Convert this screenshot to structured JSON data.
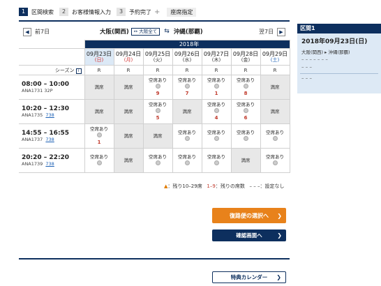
{
  "steps": [
    {
      "num": "1",
      "label": "区間検索"
    },
    {
      "num": "2",
      "label": "お客様情報入力"
    },
    {
      "num": "3",
      "label": "予約完了"
    }
  ],
  "steps_plus": "+",
  "steps_extra": "座席指定",
  "nav": {
    "prev": "前7日",
    "next": "翌7日",
    "origin": "大阪(関西)",
    "all_button": "大阪全て",
    "destination": "沖縄(那覇)"
  },
  "year": "2018年",
  "dates": [
    {
      "date": "09月23日",
      "dow": "(日)",
      "type": "sun"
    },
    {
      "date": "09月24日",
      "dow": "(月)",
      "type": "sun"
    },
    {
      "date": "09月25日",
      "dow": "(火)",
      "type": "wd"
    },
    {
      "date": "09月26日",
      "dow": "(水)",
      "type": "wd"
    },
    {
      "date": "09月27日",
      "dow": "(木)",
      "type": "wd"
    },
    {
      "date": "09月28日",
      "dow": "(金)",
      "type": "wd"
    },
    {
      "date": "09月29日",
      "dow": "(土)",
      "type": "sat"
    }
  ],
  "season_label": "シーズン",
  "season_icon": "i",
  "seasons": [
    "R",
    "R",
    "R",
    "R",
    "R",
    "R",
    "R"
  ],
  "flights": [
    {
      "time": "08:00 – 10:00",
      "number": "ANA1731",
      "aircraft": "32P",
      "aircraft_link": false,
      "cells": [
        {
          "s": "満席",
          "n": ""
        },
        {
          "s": "満席",
          "n": ""
        },
        {
          "s": "空席あり",
          "n": "9"
        },
        {
          "s": "空席あり",
          "n": "7"
        },
        {
          "s": "空席あり",
          "n": "1"
        },
        {
          "s": "空席あり",
          "n": "8"
        },
        {
          "s": "満席",
          "n": ""
        }
      ]
    },
    {
      "time": "10:20 – 12:30",
      "number": "ANA1735",
      "aircraft": "738",
      "aircraft_link": true,
      "cells": [
        {
          "s": "満席",
          "n": ""
        },
        {
          "s": "満席",
          "n": ""
        },
        {
          "s": "空席あり",
          "n": "5"
        },
        {
          "s": "満席",
          "n": ""
        },
        {
          "s": "空席あり",
          "n": "4"
        },
        {
          "s": "空席あり",
          "n": "6"
        },
        {
          "s": "満席",
          "n": ""
        }
      ]
    },
    {
      "time": "14:55 – 16:55",
      "number": "ANA1737",
      "aircraft": "738",
      "aircraft_link": true,
      "cells": [
        {
          "s": "空席あり",
          "n": "1"
        },
        {
          "s": "満席",
          "n": ""
        },
        {
          "s": "満席",
          "n": ""
        },
        {
          "s": "空席あり",
          "n": ""
        },
        {
          "s": "空席あり",
          "n": ""
        },
        {
          "s": "空席あり",
          "n": ""
        },
        {
          "s": "空席あり",
          "n": ""
        }
      ]
    },
    {
      "time": "20:20 – 22:20",
      "number": "ANA1739",
      "aircraft": "738",
      "aircraft_link": true,
      "cells": [
        {
          "s": "空席あり",
          "n": ""
        },
        {
          "s": "満席",
          "n": ""
        },
        {
          "s": "空席あり",
          "n": ""
        },
        {
          "s": "空席あり",
          "n": ""
        },
        {
          "s": "空席あり",
          "n": ""
        },
        {
          "s": "満席",
          "n": ""
        },
        {
          "s": "空席あり",
          "n": ""
        }
      ]
    }
  ],
  "legend": {
    "tri_symbol": "▲",
    "tri_text": "：残り10–29席",
    "range_symbol": "1–9",
    "range_text": "：残りの席数",
    "dash_symbol": "– – –",
    "dash_text": "：設定なし"
  },
  "buttons": {
    "return": "復路便の選択へ",
    "confirm": "確認画面へ",
    "calendar": "特典カレンダー"
  },
  "sidebar": {
    "title": "区間1",
    "date": "2018年09月23日(日)",
    "origin": "大阪(関西)",
    "destination": "沖縄(那覇)",
    "row1": "– – – – – – –",
    "row2": "– – –",
    "row3": "– – –"
  },
  "colors": {
    "navy": "#0d2f5e",
    "orange": "#e8821b",
    "full": "#e8e8e8",
    "selected": "#dce9f6"
  }
}
